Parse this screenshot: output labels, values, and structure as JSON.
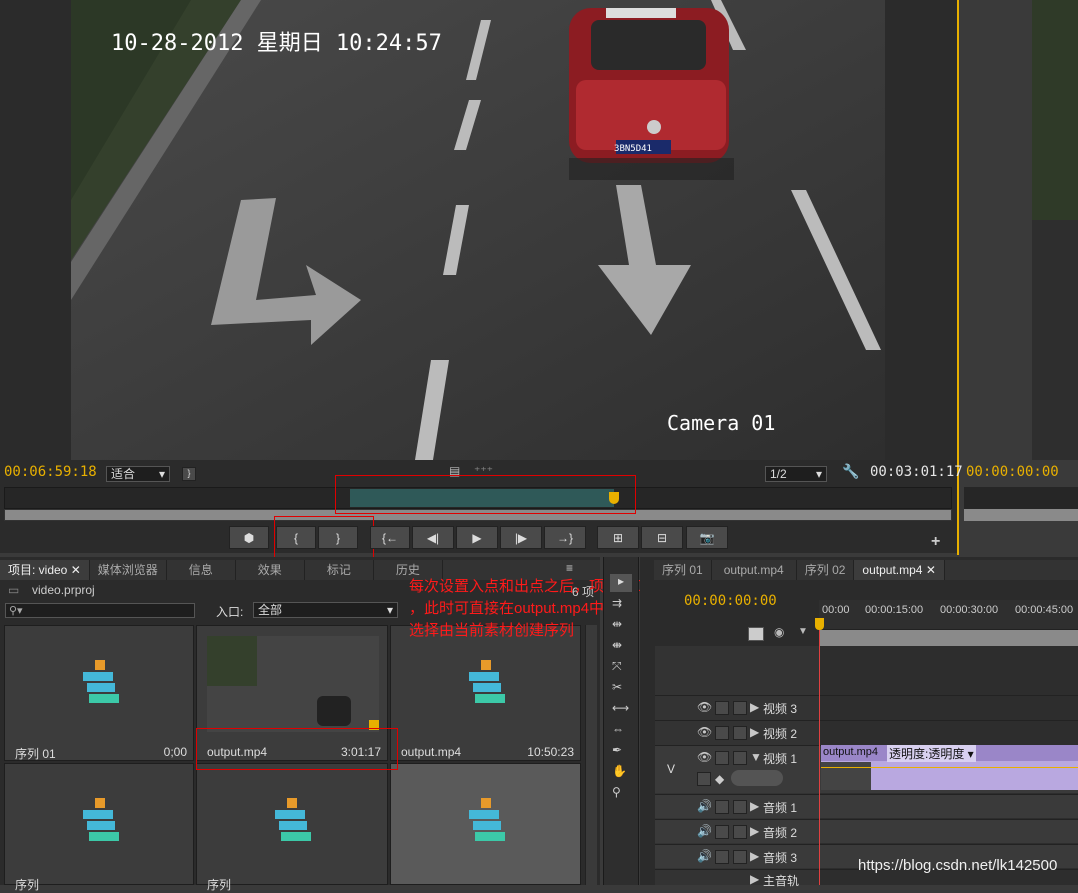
{
  "source_monitor": {
    "overlay_datetime": "10-28-2012 星期日 10:24:57",
    "overlay_camera": "Camera 01",
    "plate": "3BN5D41",
    "taxi_sign": "▭▭▭ ▭▭▭",
    "current_time": "00:06:59:18",
    "zoom_select": "适合",
    "resolution_select": "1/2",
    "duration": "00:03:01:17"
  },
  "program_monitor": {
    "current_time": "00:00:00:00"
  },
  "project_panel": {
    "tabs": [
      "项目: video",
      "媒体浏览器",
      "信息",
      "效果",
      "标记",
      "历史"
    ],
    "project_file": "video.prproj",
    "item_count": "6 项",
    "search_placeholder": "",
    "in_label": "入口:",
    "in_select": "全部",
    "items": [
      {
        "name": "序列 01",
        "duration": "0;00",
        "kind": "sequence"
      },
      {
        "name": "output.mp4",
        "duration": "3:01:17",
        "kind": "video"
      },
      {
        "name": "output.mp4",
        "duration": "10:50:23",
        "kind": "sequence"
      },
      {
        "name": "序列",
        "duration": "",
        "kind": "sequence"
      },
      {
        "name": "序列",
        "duration": "",
        "kind": "sequence"
      },
      {
        "name": "",
        "duration": "",
        "kind": "sequence"
      }
    ]
  },
  "annotation": {
    "line1": "每次设置入点和出点之后，项目窗口中的素材会自动改变",
    "line2": "，此时可直接在output.mp4中右击",
    "line3": "选择由当前素材创建序列"
  },
  "timeline": {
    "tabs": [
      "序列 01",
      "output.mp4",
      "序列 02",
      "output.mp4"
    ],
    "current_time": "00:00:00:00",
    "ruler": [
      "00:00",
      "00:00:15:00",
      "00:00:30:00",
      "00:00:45:00"
    ],
    "target_v": "V",
    "tracks": [
      {
        "name": "视频 3",
        "type": "video"
      },
      {
        "name": "视频 2",
        "type": "video"
      },
      {
        "name": "视频 1",
        "type": "video"
      },
      {
        "name": "音频 1",
        "type": "audio"
      },
      {
        "name": "音频 2",
        "type": "audio"
      },
      {
        "name": "音频 3",
        "type": "audio"
      },
      {
        "name": "主音轨",
        "type": "master"
      }
    ],
    "clip_name": "output.mp4",
    "clip_effect": "透明度:透明度 ▾"
  },
  "watermark": "https://blog.csdn.net/lk142500",
  "colors": {
    "accent": "#e8b000",
    "red": "#e00000",
    "clip": "#9a86c8"
  }
}
